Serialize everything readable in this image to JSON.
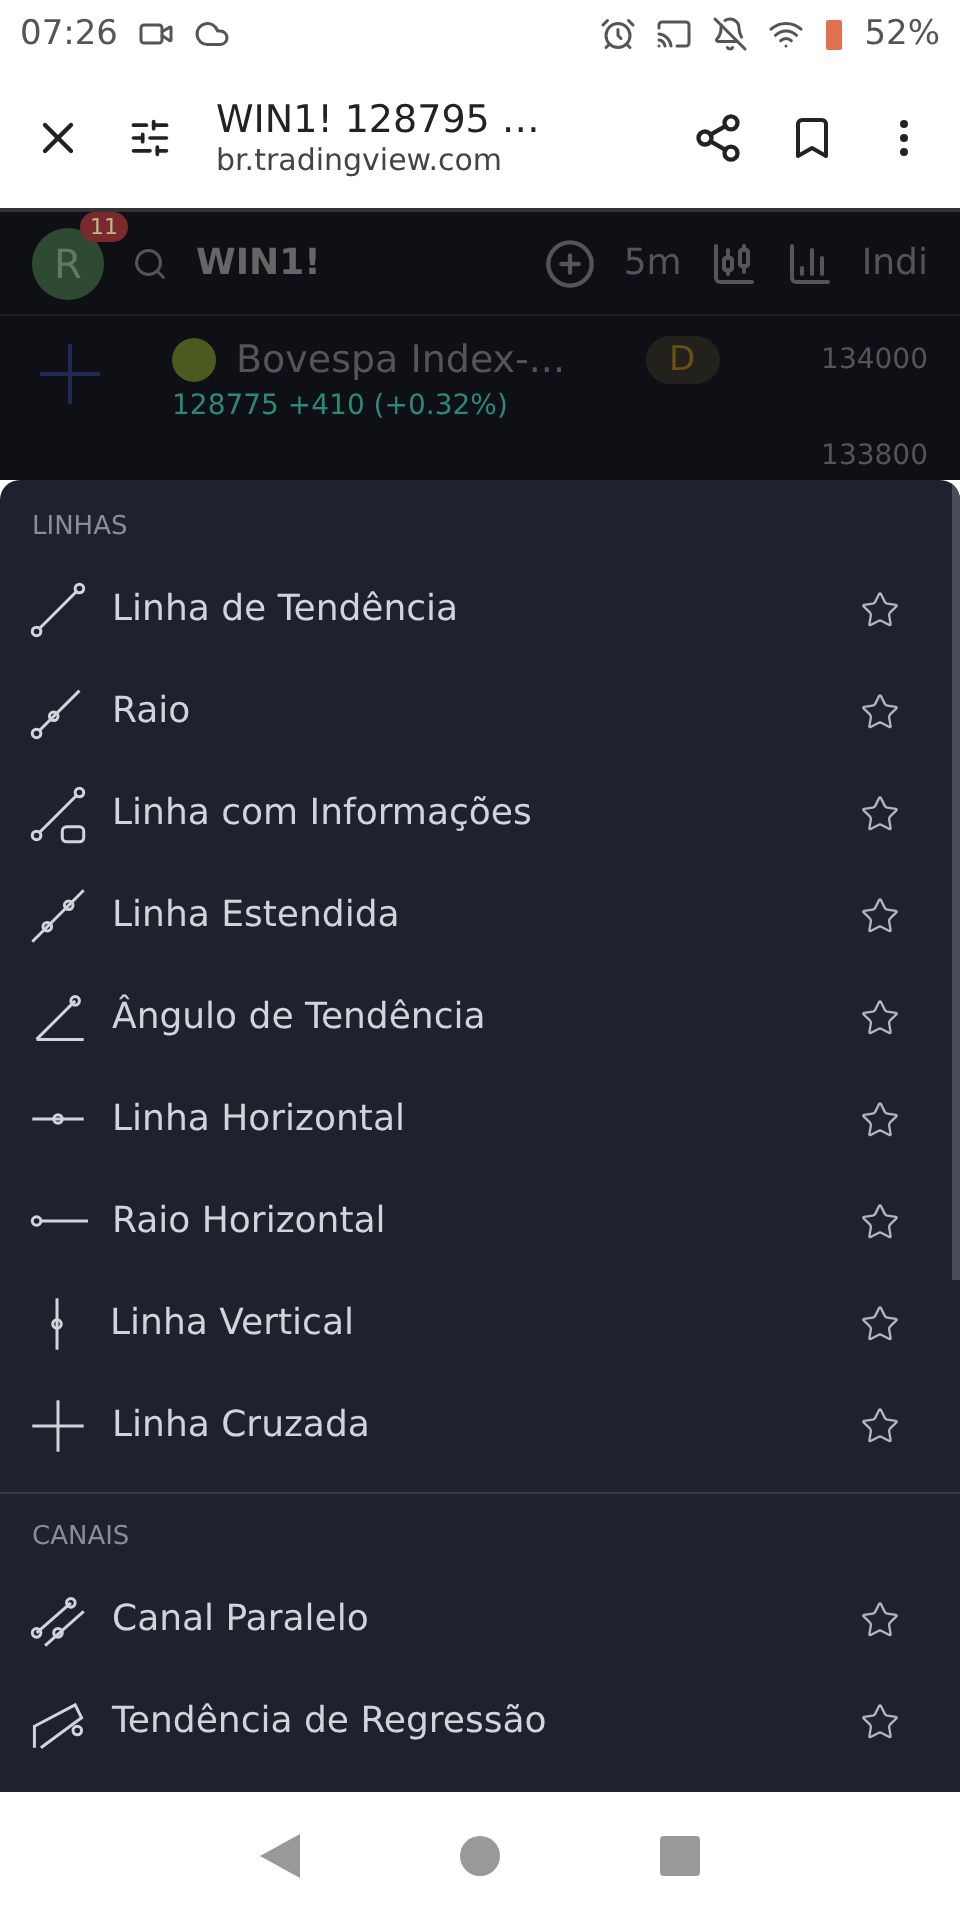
{
  "status_bar": {
    "time": "07:26",
    "battery": "52%"
  },
  "browser": {
    "title": "WIN1! 128795 …",
    "url": "br.tradingview.com"
  },
  "chart": {
    "badge": "11",
    "avatar": "R",
    "symbol": "WIN1!",
    "interval": "5m",
    "indicators": "Indi",
    "name": "Bovespa Index-...",
    "period": "D",
    "quote": "128775 +410 (+0.32%)",
    "prices": [
      "134000",
      "133800"
    ]
  },
  "sections": [
    {
      "title": "LINHAS",
      "items": [
        {
          "label": "Linha de Tendência",
          "favorite": false
        },
        {
          "label": "Raio",
          "favorite": false
        },
        {
          "label": "Linha com Informações",
          "favorite": false
        },
        {
          "label": "Linha Estendida",
          "favorite": false
        },
        {
          "label": "Ângulo de Tendência",
          "favorite": false
        },
        {
          "label": "Linha Horizontal",
          "favorite": false
        },
        {
          "label": "Raio Horizontal",
          "favorite": false
        },
        {
          "label": "Linha Vertical",
          "favorite": false
        },
        {
          "label": "Linha Cruzada",
          "favorite": false
        }
      ]
    },
    {
      "title": "CANAIS",
      "items": [
        {
          "label": "Canal Paralelo",
          "favorite": false
        },
        {
          "label": "Tendência de Regressão",
          "favorite": false
        }
      ]
    }
  ]
}
